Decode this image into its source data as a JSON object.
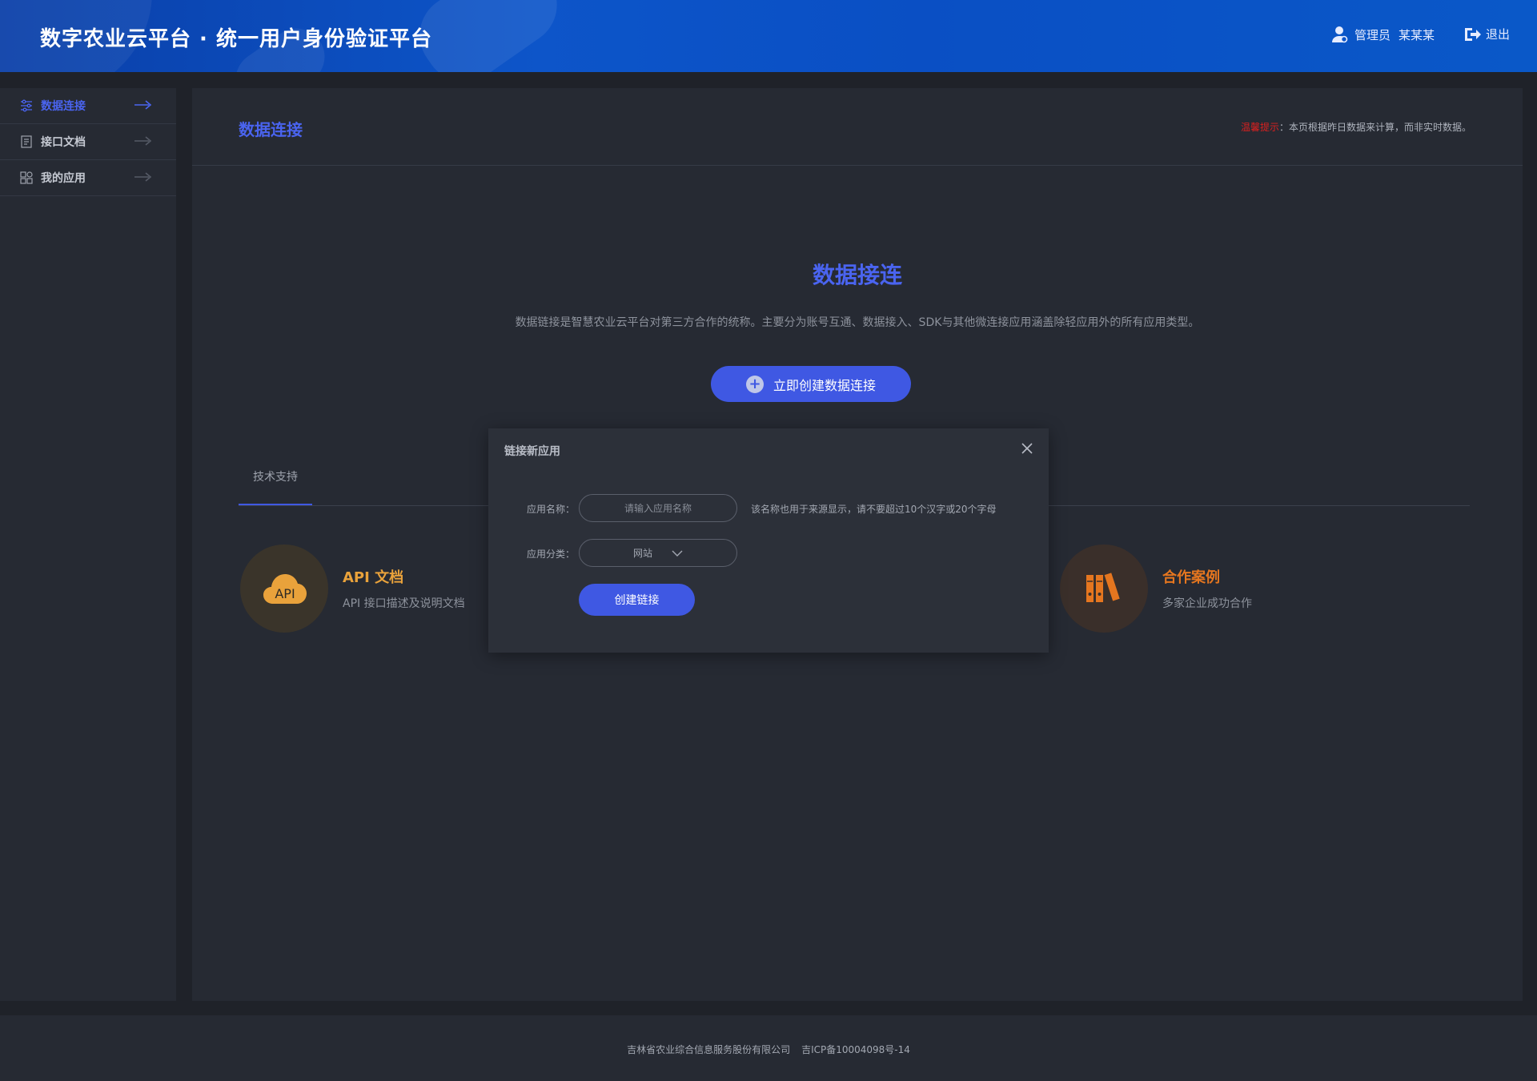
{
  "header": {
    "title": "数字农业云平台 · 统一用户身份验证平台",
    "user_role": "管理员",
    "user_name": "某某某",
    "logout_label": "退出"
  },
  "sidebar": {
    "items": [
      {
        "label": "数据连接",
        "icon": "sliders-icon",
        "active": true
      },
      {
        "label": "接口文档",
        "icon": "document-icon",
        "active": false
      },
      {
        "label": "我的应用",
        "icon": "apps-icon",
        "active": false
      }
    ]
  },
  "main": {
    "title": "数据连接",
    "notice_label": "温馨提示",
    "notice_text": "：本页根据昨日数据来计算，而非实时数据。",
    "hero_title": "数据接连",
    "hero_desc": "数据链接是智慧农业云平台对第三方合作的统称。主要分为账号互通、数据接入、SDK与其他微连接应用涵盖除轻应用外的所有应用类型。",
    "create_button": "立即创建数据连接",
    "tabs": [
      {
        "label": "技术支持"
      }
    ],
    "cards": [
      {
        "title": "API 文档",
        "subtitle": "API 接口描述及说明文档",
        "icon": "api-cloud-icon",
        "color": "#e9a23b"
      },
      {
        "title": "合作案例",
        "subtitle": "多家企业成功合作",
        "icon": "binders-icon",
        "color": "#e5761f"
      }
    ],
    "api_icon_text": "API"
  },
  "modal": {
    "title": "链接新应用",
    "name_label": "应用名称：",
    "name_placeholder": "请输入应用名称",
    "name_value": "",
    "name_hint": "该名称也用于来源显示，请不要超过10个汉字或20个字母",
    "category_label": "应用分类：",
    "category_value": "网站",
    "submit_label": "创建链接"
  },
  "footer": {
    "company": "吉林省农业综合信息服务股份有限公司",
    "icp": "吉ICP备10004098号-14"
  },
  "colors": {
    "accent": "#3f58e3",
    "header": "#0d55c9",
    "warning": "#d9201f"
  }
}
